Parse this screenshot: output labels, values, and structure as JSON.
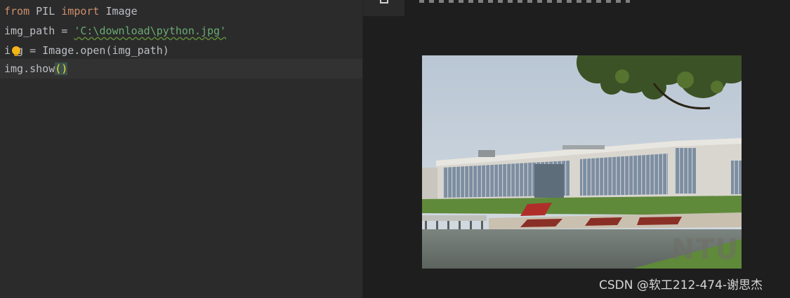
{
  "editor": {
    "lines": [
      {
        "seg1": "from",
        "seg2": " PIL ",
        "seg3": "import",
        "seg4": " Image"
      },
      {
        "prefix": "img_path = ",
        "string": "'C:\\download\\python.jpg'"
      },
      {
        "prefix": "i",
        "rest": "g = Image.open(img_path)"
      },
      {
        "prefix": "img.show",
        "paren": "()"
      }
    ]
  },
  "preview": {
    "image_watermark": "NTU",
    "credit": "CSDN @软工212-474-谢思杰"
  },
  "colors": {
    "keyword": "#cf8e6d",
    "string": "#6aab73",
    "text": "#bcbec4",
    "editor_bg": "#2b2b2b",
    "preview_bg": "#1e1e1e"
  },
  "icons": [
    "intention-bulb-icon",
    "tab-icon"
  ]
}
